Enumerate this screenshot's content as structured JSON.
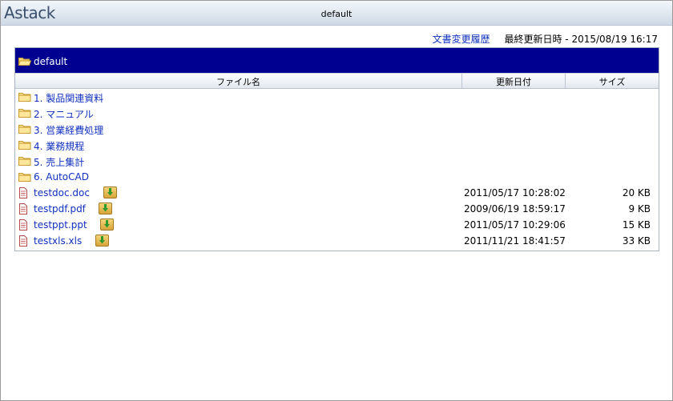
{
  "app": {
    "name": "Astack",
    "folder_title": "default"
  },
  "toolbar": {
    "history_link": "文書変更履歴",
    "last_updated_label": "最終更新日時",
    "last_updated_value": "2015/08/19 16:17"
  },
  "panel": {
    "folder_name": "default",
    "columns": {
      "name": "ファイル名",
      "updated": "更新日付",
      "size": "サイズ"
    },
    "folders": [
      {
        "name": "1. 製品関連資料"
      },
      {
        "name": "2. マニュアル"
      },
      {
        "name": "3. 営業経費処理"
      },
      {
        "name": "4. 業務規程"
      },
      {
        "name": "5. 売上集計"
      },
      {
        "name": "6. AutoCAD"
      }
    ],
    "files": [
      {
        "name": "testdoc.doc",
        "updated": "2011/05/17 10:28:02",
        "size": "20 KB"
      },
      {
        "name": "testpdf.pdf",
        "updated": "2009/06/19 18:59:17",
        "size": "9 KB"
      },
      {
        "name": "testppt.ppt",
        "updated": "2011/05/17 10:29:06",
        "size": "15 KB"
      },
      {
        "name": "testxls.xls",
        "updated": "2011/11/21 18:41:57",
        "size": "33 KB"
      }
    ]
  },
  "icons": {
    "folder": "folder-icon",
    "open_folder": "open-folder-icon",
    "file": "document-icon",
    "download": "download-icon"
  },
  "colors": {
    "header_bg": "#000090",
    "link": "#1030c0"
  }
}
